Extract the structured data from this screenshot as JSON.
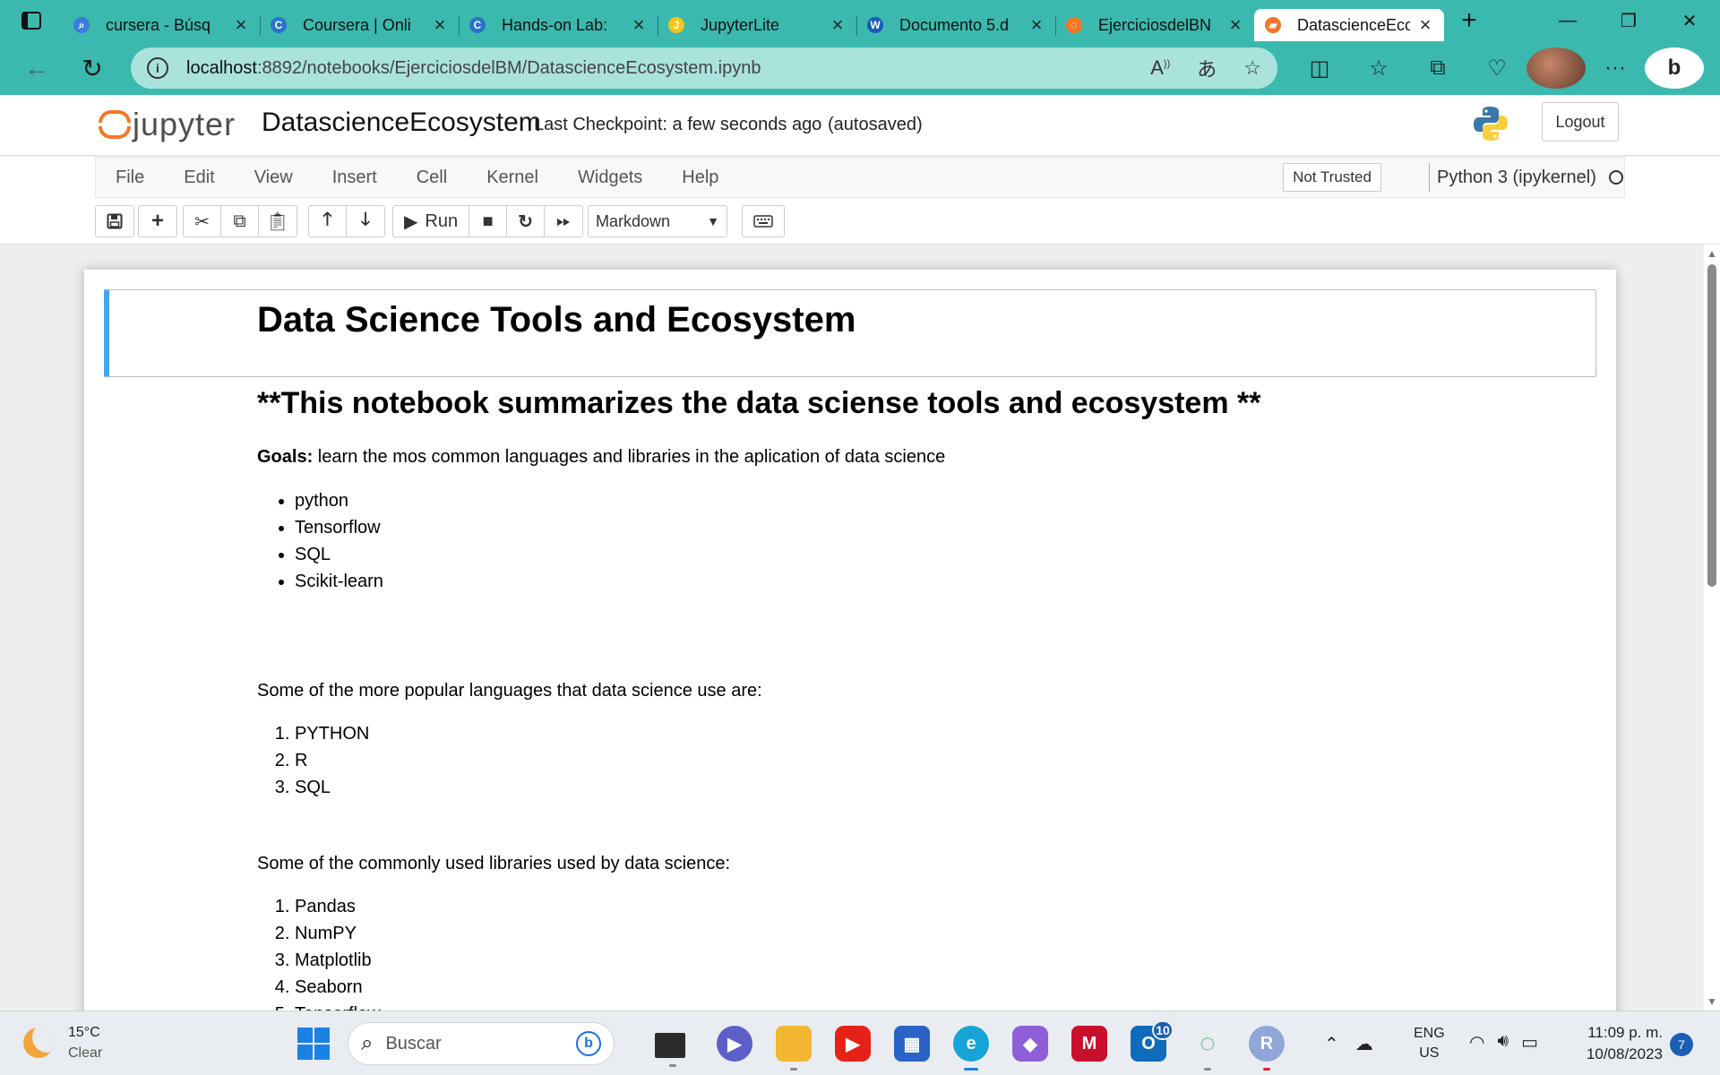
{
  "browser": {
    "tabs": [
      {
        "title": "cursera - Búsq",
        "icon": "search-icon",
        "color": "#3b7ddd"
      },
      {
        "title": "Coursera | Onli",
        "icon": "coursera-icon",
        "color": "#2a73cc"
      },
      {
        "title": "Hands-on Lab:",
        "icon": "coursera-icon",
        "color": "#2a73cc"
      },
      {
        "title": "JupyterLite",
        "icon": "jupyterlite-icon",
        "color": "#f5c518"
      },
      {
        "title": "Documento 5.d",
        "icon": "word-icon",
        "color": "#185abd"
      },
      {
        "title": "EjerciciosdelBN",
        "icon": "jupyter-icon",
        "color": "#f37726"
      },
      {
        "title": "DatascienceEco",
        "icon": "notebook-icon",
        "color": "#f37726"
      }
    ],
    "url_host": "localhost",
    "url_path": ":8892/notebooks/EjerciciosdelBM/DatascienceEcosystem.ipynb",
    "accent_color": "#3bb9ae"
  },
  "jupyter": {
    "logo_text": "jupyter",
    "notebook_name": "DatascienceEcosystem",
    "checkpoint": "Last Checkpoint: a few seconds ago",
    "autosave": "(autosaved)",
    "logout_label": "Logout",
    "menu": [
      "File",
      "Edit",
      "View",
      "Insert",
      "Cell",
      "Kernel",
      "Widgets",
      "Help"
    ],
    "trust_label": "Not Trusted",
    "kernel_label": "Python 3 (ipykernel)",
    "run_label": "Run",
    "cell_type": "Markdown"
  },
  "notebook": {
    "title": "Data Science Tools and Ecosystem",
    "subtitle": "**This notebook summarizes the data sciense tools and ecosystem **",
    "goals_label": "Goals:",
    "goals_text": " learn the mos common languages and libraries in the aplication of data science",
    "goals_list": [
      "python",
      "Tensorflow",
      "SQL",
      "Scikit-learn"
    ],
    "languages_intro": "Some of the more popular languages that data science use are:",
    "languages": [
      "PYTHON",
      "R",
      "SQL"
    ],
    "libraries_intro": "Some of the commonly used libraries used by data science:",
    "libraries": [
      "Pandas",
      "NumPY",
      "Matplotlib",
      "Seaborn",
      "Tensorflow"
    ]
  },
  "taskbar": {
    "temperature": "15°C",
    "condition": "Clear",
    "search_placeholder": "Buscar",
    "outlook_badge": "10",
    "lang_top": "ENG",
    "lang_bottom": "US",
    "time": "11:09 p. m.",
    "date": "10/08/2023",
    "notifications": "7"
  }
}
